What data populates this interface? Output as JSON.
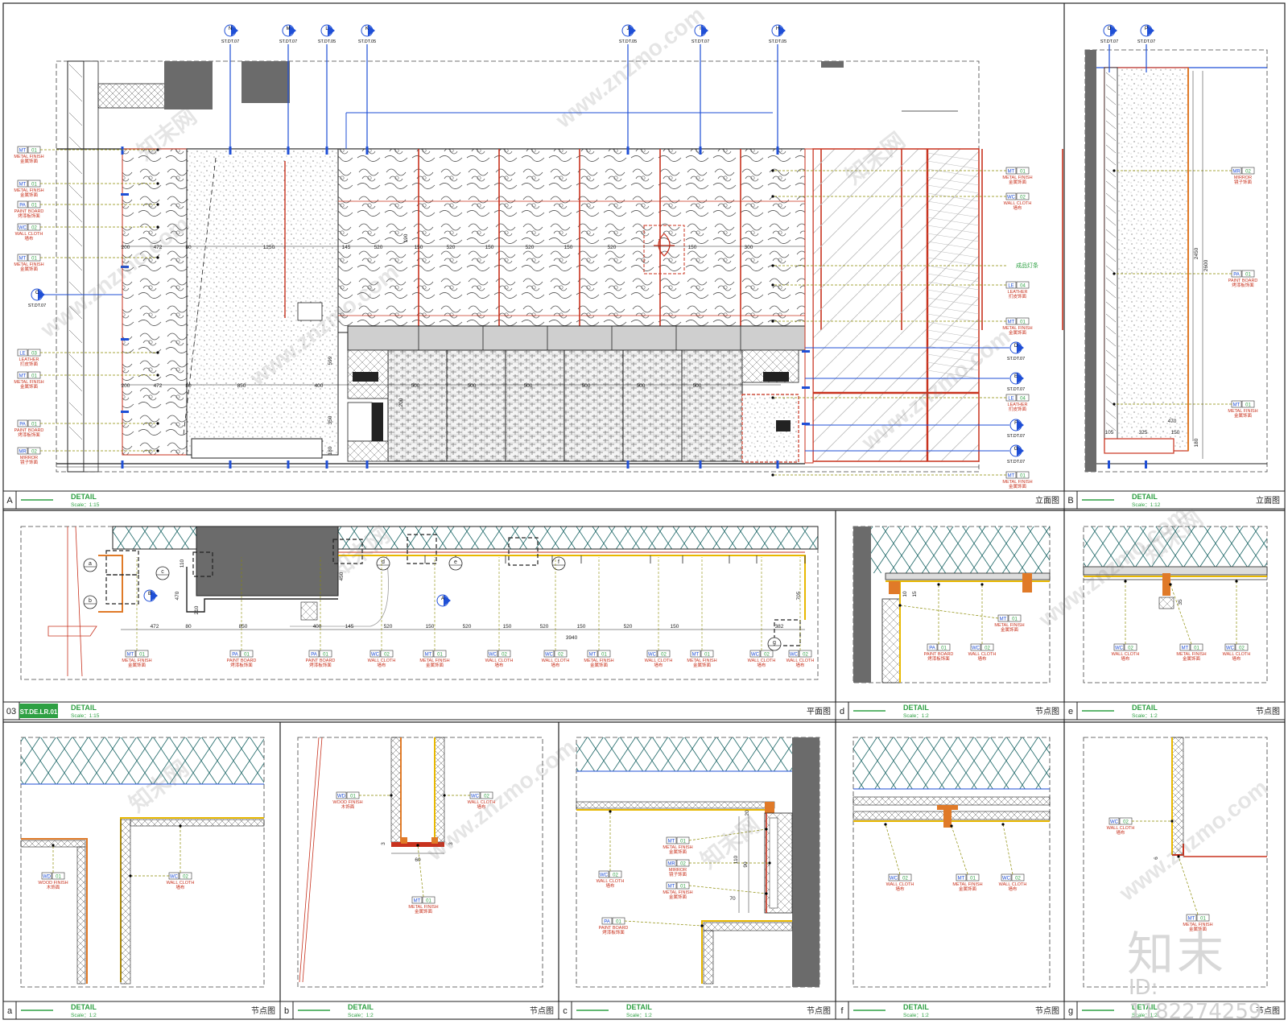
{
  "colors": {
    "frame": "#1a1a1a",
    "blue": "#1f4fd6",
    "red": "#c8321e",
    "orange": "#e07a28",
    "yellow": "#e8b800",
    "green": "#2ea043",
    "olive": "#8a8a00",
    "hatch": "#2a7070",
    "grey": "#6b6b6b"
  },
  "panels": [
    {
      "letter": "A",
      "title": "DETAIL",
      "scale": "Scale：1:15",
      "type": "立面图"
    },
    {
      "letter": "B",
      "title": "DETAIL",
      "scale": "Scale：1:12",
      "type": "立面图"
    },
    {
      "letter": "03",
      "ref": "ST.DE.LR.01",
      "title": "DETAIL",
      "scale": "Scale：1:15",
      "type": "平面图"
    },
    {
      "letter": "d",
      "title": "DETAIL",
      "scale": "Scale：1:2",
      "type": "节点图"
    },
    {
      "letter": "e",
      "title": "DETAIL",
      "scale": "Scale：1:2",
      "type": "节点图"
    },
    {
      "letter": "a",
      "title": "DETAIL",
      "scale": "Scale：1:2",
      "type": "节点图"
    },
    {
      "letter": "b",
      "title": "DETAIL",
      "scale": "Scale：1:2",
      "type": "节点图"
    },
    {
      "letter": "c",
      "title": "DETAIL",
      "scale": "Scale：1:2",
      "type": "节点图"
    },
    {
      "letter": "f",
      "title": "DETAIL",
      "scale": "Scale：1:2",
      "type": "节点图"
    },
    {
      "letter": "g",
      "title": "DETAIL",
      "scale": "Scale：1:2",
      "type": "节点图"
    }
  ],
  "section_markers": [
    {
      "id": "N",
      "ref": "ST.DT.07"
    },
    {
      "id": "M",
      "ref": "ST.DT.07"
    },
    {
      "id": "L",
      "ref": "ST.DT.05"
    },
    {
      "id": "K",
      "ref": "ST.DT.05"
    },
    {
      "id": "J",
      "ref": "ST.DT.05"
    },
    {
      "id": "I",
      "ref": "ST.DT.07"
    },
    {
      "id": "H",
      "ref": "ST.DT.05"
    },
    {
      "id": "O",
      "ref": "ST.DT.07"
    },
    {
      "id": "P",
      "ref": "ST.DT.07"
    }
  ],
  "side_markers": [
    {
      "id": "C",
      "ref": "ST.DT.07"
    },
    {
      "id": "D",
      "ref": "ST.DT.07"
    },
    {
      "id": "E",
      "ref": "ST.DT.07"
    },
    {
      "id": "F",
      "ref": "ST.DT.07"
    },
    {
      "id": "G",
      "ref": "ST.DT.07"
    }
  ],
  "tags_left": [
    {
      "code": "MT",
      "num": "01",
      "en": "METAL FINISH",
      "cn": "金属饰面"
    },
    {
      "code": "MT",
      "num": "01",
      "en": "METAL FINISH",
      "cn": "金属饰面"
    },
    {
      "code": "PA",
      "num": "01",
      "en": "PAINT BOARD",
      "cn": "烤漆板饰面"
    },
    {
      "code": "WC",
      "num": "02",
      "en": "WALL CLOTH",
      "cn": "墙布"
    },
    {
      "code": "MT",
      "num": "01",
      "en": "METAL FINISH",
      "cn": "金属饰面"
    },
    {
      "code": "LE",
      "num": "03",
      "en": "LEATHER",
      "cn": "扪皮饰面"
    },
    {
      "code": "MT",
      "num": "01",
      "en": "METAL FINISH",
      "cn": "金属饰面"
    },
    {
      "code": "PA",
      "num": "01",
      "en": "PAINT BOARD",
      "cn": "烤漆板饰面"
    },
    {
      "code": "MR",
      "num": "02",
      "en": "MIRROR",
      "cn": "镜子饰面"
    }
  ],
  "tags_right": [
    {
      "code": "MT",
      "num": "01",
      "en": "METAL FINISH",
      "cn": "金属饰面"
    },
    {
      "code": "WC",
      "num": "02",
      "en": "WALL CLOTH",
      "cn": "墙布"
    },
    {
      "code": "LE",
      "num": "04",
      "en": "LEATHER",
      "cn": "扪皮饰面"
    },
    {
      "code": "MT",
      "num": "01",
      "en": "METAL FINISH",
      "cn": "金属饰面"
    },
    {
      "code": "LE",
      "num": "04",
      "en": "LEATHER",
      "cn": "扪皮饰面"
    },
    {
      "code": "MT",
      "num": "01",
      "en": "METAL FINISH",
      "cn": "金属饰面"
    }
  ],
  "light_label": "成品灯条",
  "elev_a_dims": {
    "top": [
      "200",
      "472",
      "80",
      "1250",
      "145",
      "520",
      "150",
      "520",
      "150",
      "520",
      "150",
      "520",
      "150",
      "300"
    ],
    "bottom": [
      "200",
      "472",
      "80",
      "850",
      "400",
      "500",
      "500",
      "500",
      "500",
      "500",
      "500"
    ]
  },
  "elev_b": {
    "tags": [
      {
        "code": "MR",
        "num": "02",
        "en": "MIRROR",
        "cn": "镜子饰面"
      },
      {
        "code": "PA",
        "num": "01",
        "en": "PAINT BOARD",
        "cn": "烤漆板饰面"
      },
      {
        "code": "MT",
        "num": "01",
        "en": "METAL FINISH",
        "cn": "金属饰面"
      }
    ],
    "dims": [
      "105",
      "325",
      "150",
      "470",
      "2450",
      "2600",
      "180"
    ]
  },
  "plan": {
    "dims": [
      "472",
      "80",
      "850",
      "400",
      "145",
      "520",
      "150",
      "520",
      "150",
      "520",
      "150",
      "520",
      "150",
      "382",
      "3940"
    ],
    "vdims": [
      "110",
      "470",
      "210",
      "450",
      "705"
    ],
    "markers": [
      "a",
      "b",
      "c",
      "d",
      "e",
      "f",
      "g",
      "A",
      "B"
    ],
    "tags": [
      {
        "code": "MT",
        "num": "01",
        "en": "METAL FINISH",
        "cn": "金属饰面"
      },
      {
        "code": "PA",
        "num": "01",
        "en": "PAINT BOARD",
        "cn": "烤漆板饰面"
      },
      {
        "code": "PA",
        "num": "01",
        "en": "PAINT BOARD",
        "cn": "烤漆板饰面"
      },
      {
        "code": "WC",
        "num": "02",
        "en": "WALL CLOTH",
        "cn": "墙布"
      },
      {
        "code": "MT",
        "num": "01",
        "en": "METAL FINISH",
        "cn": "金属饰面"
      },
      {
        "code": "WC",
        "num": "02",
        "en": "WALL CLOTH",
        "cn": "墙布"
      },
      {
        "code": "WC",
        "num": "02",
        "en": "WALL CLOTH",
        "cn": "墙布"
      },
      {
        "code": "MT",
        "num": "01",
        "en": "METAL FINISH",
        "cn": "金属饰面"
      },
      {
        "code": "WC",
        "num": "02",
        "en": "WALL CLOTH",
        "cn": "墙布"
      },
      {
        "code": "MT",
        "num": "01",
        "en": "METAL FINISH",
        "cn": "金属饰面"
      },
      {
        "code": "WC",
        "num": "02",
        "en": "WALL CLOTH",
        "cn": "墙布"
      },
      {
        "code": "WC",
        "num": "02",
        "en": "WALL CLOTH",
        "cn": "墙布"
      }
    ]
  },
  "node_d": {
    "tags": [
      {
        "code": "MT",
        "num": "01",
        "en": "METAL FINISH",
        "cn": "金属饰面"
      },
      {
        "code": "PA",
        "num": "01",
        "en": "PAINT BOARD",
        "cn": "烤漆板饰面"
      },
      {
        "code": "WC",
        "num": "02",
        "en": "WALL CLOTH",
        "cn": "墙布"
      }
    ],
    "dims": [
      "10",
      "15"
    ]
  },
  "node_e": {
    "tags": [
      {
        "code": "WC",
        "num": "02",
        "en": "WALL CLOTH",
        "cn": "墙布"
      },
      {
        "code": "MT",
        "num": "01",
        "en": "METAL FINISH",
        "cn": "金属饰面"
      },
      {
        "code": "WC",
        "num": "02",
        "en": "WALL CLOTH",
        "cn": "墙布"
      }
    ],
    "dims": [
      "35"
    ]
  },
  "node_a": {
    "tags": [
      {
        "code": "WD",
        "num": "01",
        "en": "WOOD FINISH",
        "cn": "木饰面"
      },
      {
        "code": "WC",
        "num": "02",
        "en": "WALL CLOTH",
        "cn": "墙布"
      }
    ]
  },
  "node_b": {
    "tags": [
      {
        "code": "WD",
        "num": "01",
        "en": "WOOD FINISH",
        "cn": "木饰面"
      },
      {
        "code": "WC",
        "num": "02",
        "en": "WALL CLOTH",
        "cn": "墙布"
      },
      {
        "code": "MT",
        "num": "01",
        "en": "METAL FINISH",
        "cn": "金属饰面"
      }
    ],
    "dims": [
      "60",
      "3",
      "3"
    ]
  },
  "node_c": {
    "tags": [
      {
        "code": "MT",
        "num": "01",
        "en": "METAL FINISH",
        "cn": "金属饰面"
      },
      {
        "code": "MR",
        "num": "02",
        "en": "MIRROR",
        "cn": "镜子饰面"
      },
      {
        "code": "MT",
        "num": "01",
        "en": "METAL FINISH",
        "cn": "金属饰面"
      },
      {
        "code": "WC",
        "num": "02",
        "en": "WALL CLOTH",
        "cn": "墙布"
      },
      {
        "code": "PA",
        "num": "01",
        "en": "PAINT BOARD",
        "cn": "烤漆板饰面"
      }
    ],
    "dims": [
      "110",
      "90",
      "70",
      "20"
    ]
  },
  "node_f": {
    "tags": [
      {
        "code": "WC",
        "num": "02",
        "en": "WALL CLOTH",
        "cn": "墙布"
      },
      {
        "code": "MT",
        "num": "01",
        "en": "METAL FINISH",
        "cn": "金属饰面"
      },
      {
        "code": "WC",
        "num": "02",
        "en": "WALL CLOTH",
        "cn": "墙布"
      }
    ]
  },
  "node_g": {
    "tags": [
      {
        "code": "WC",
        "num": "02",
        "en": "WALL CLOTH",
        "cn": "墙布"
      },
      {
        "code": "MT",
        "num": "01",
        "en": "METAL FINISH",
        "cn": "金属饰面"
      }
    ],
    "dims": [
      "6"
    ]
  },
  "watermark": "www.znzmo.com",
  "watermark_cn": "知末网",
  "logo": "知末",
  "id_text": "ID: 1182274259"
}
